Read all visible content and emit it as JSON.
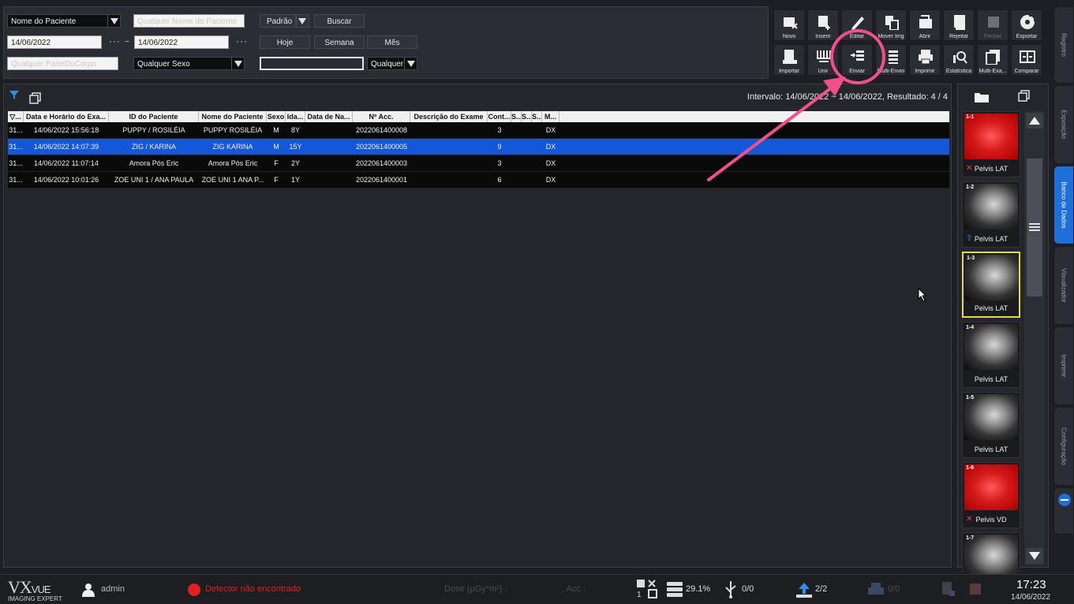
{
  "filters": {
    "search_field": "Nome do Paciente",
    "search_placeholder": "Qualquer Nome do Paciente",
    "preset": "Padrão",
    "search_button": "Buscar",
    "date_from": "14/06/2022",
    "date_separator": "~",
    "date_to": "14/06/2022",
    "dots": "···",
    "today_button": "Hoje",
    "week_button": "Semana",
    "month_button": "Mês",
    "body_part_placeholder": "Qualquer ParteDoCorpo",
    "sex": "Qualquer Sexo",
    "blank_field": "",
    "any": "Qualquer"
  },
  "toolbar": {
    "row1": [
      "Novo",
      "Inserir",
      "Editar",
      "Mover Img",
      "Abrir",
      "Rejeitar",
      "Fechar",
      "Exportar"
    ],
    "row2": [
      "Importar",
      "Unir",
      "Enviar",
      "Multi-Envio",
      "Imprimir",
      "Estatística",
      "Multi-Exa...",
      "Comparar"
    ]
  },
  "side_tabs": [
    "Registro",
    "Exposição",
    "Banco de Dados",
    "Visualizador",
    "Imprimir",
    "Configuração"
  ],
  "table": {
    "range_text": "Intervalo: 14/06/2022 ~ 14/06/2022, Resultado: 4 / 4",
    "columns": [
      "▽...",
      "Data e Horário do Exa...",
      "ID do Paciente",
      "Nome do Paciente",
      "Sexo",
      "Ida...",
      "Data de Na...",
      "Nº Acc.",
      "Descrição do Exame",
      "Cont...",
      "S...",
      "S...",
      "S...",
      "M..."
    ],
    "rows": [
      [
        "31...",
        "14/06/2022 15:56:18",
        "PUPPY / ROSILÉIA",
        "PUPPY ROSILÉIA",
        "M",
        "8Y",
        "",
        "2022061400008",
        "",
        "3",
        "",
        "",
        "",
        "DX"
      ],
      [
        "31...",
        "14/06/2022 14:07:39",
        "ZIG / KARINA",
        "ZIG KARINA",
        "M",
        "15Y",
        "",
        "2022061400005",
        "",
        "9",
        "",
        "",
        "",
        "DX"
      ],
      [
        "31...",
        "14/06/2022 11:07:14",
        "Amora Pós Eric",
        "Amora Pós Eric",
        "F",
        "2Y",
        "",
        "2022061400003",
        "",
        "3",
        "",
        "",
        "",
        "DX"
      ],
      [
        "31...",
        "14/06/2022 10:01:26",
        "ZOE UNI 1 / ANA PAULA",
        "ZOE UNI 1  ANA P...",
        "F",
        "1Y",
        "",
        "2022061400001",
        "",
        "6",
        "",
        "",
        "",
        "DX"
      ]
    ],
    "selected_row": 1
  },
  "thumbnails": [
    {
      "num": "1-1",
      "label": "Pelvis LAT",
      "style": "red",
      "mark": "✕"
    },
    {
      "num": "1-2",
      "label": "Pelvis LAT",
      "style": "xray",
      "mark": "⇧"
    },
    {
      "num": "1-3",
      "label": "Pelvis LAT",
      "style": "xray",
      "mark": ""
    },
    {
      "num": "1-4",
      "label": "Pelvis LAT",
      "style": "xray",
      "mark": ""
    },
    {
      "num": "1-5",
      "label": "Pelvis LAT",
      "style": "xray",
      "mark": ""
    },
    {
      "num": "1-6",
      "label": "Pelvis VD",
      "style": "red",
      "mark": "✕"
    },
    {
      "num": "1-7",
      "label": "",
      "style": "xray",
      "mark": ""
    }
  ],
  "status": {
    "brand": "VX",
    "brand_sub": "VUE",
    "brand_tag": "IMAGING EXPERT",
    "user": "admin",
    "detector": "Detector não encontrado",
    "dose": "Dose (µGy*m²) :",
    "acc": ", Acc :",
    "grid_count": "1",
    "disk": "29.1%",
    "usb": "0/0",
    "upload": "2/2",
    "print": "0/0",
    "time": "17:23",
    "date": "14/06/2022"
  },
  "colors": {
    "selection": "#1557d9",
    "active_tab": "#1e6fd8",
    "annotation": "#f0508a",
    "detector_status": "#e02020"
  }
}
